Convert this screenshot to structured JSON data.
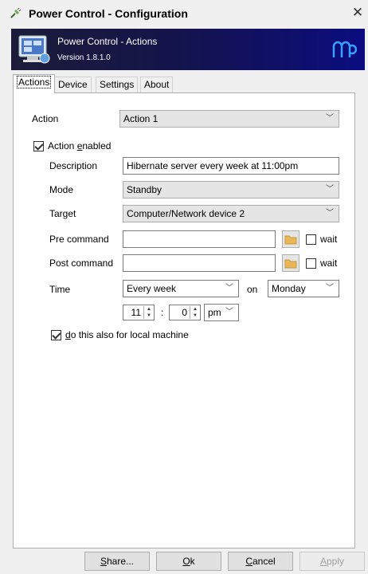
{
  "window": {
    "title": "Power Control - Configuration"
  },
  "banner": {
    "title": "Power Control - Actions",
    "version": "Version 1.8.1.0"
  },
  "tabs": [
    {
      "label": "Actions"
    },
    {
      "label": "Device"
    },
    {
      "label": "Settings"
    },
    {
      "label": "About"
    }
  ],
  "form": {
    "action_label": "Action",
    "action_value": "Action 1",
    "enabled_label_pre": "Action ",
    "enabled_label_u": "e",
    "enabled_label_post": "nabled",
    "description_label": "Description",
    "description_value": "Hibernate server every week at 11:00pm",
    "mode_label": "Mode",
    "mode_value": "Standby",
    "target_label": "Target",
    "target_value": "Computer/Network device 2",
    "pre_command_label": "Pre command",
    "pre_command_value": "",
    "post_command_label": "Post command",
    "post_command_value": "",
    "wait_label": "wait",
    "time_label": "Time",
    "time_recurrence": "Every week",
    "on_label": "on",
    "day_value": "Monday",
    "hour_value": "11",
    "colon": ":",
    "minute_value": "0",
    "ampm_value": "pm",
    "local_label_u": "d",
    "local_label_post": "o this also for local machine"
  },
  "buttons": {
    "share_u": "S",
    "share_post": "hare...",
    "ok_u": "O",
    "ok_post": "k",
    "cancel_u": "C",
    "cancel_post": "ancel",
    "apply_u": "A",
    "apply_post": "pply"
  },
  "icons": {
    "app": "power-plug-icon",
    "banner": "monitor-icon",
    "logo": "brand-logo-icon",
    "close": "close-icon",
    "folder": "folder-icon",
    "chevron": "chevron-down-icon"
  }
}
